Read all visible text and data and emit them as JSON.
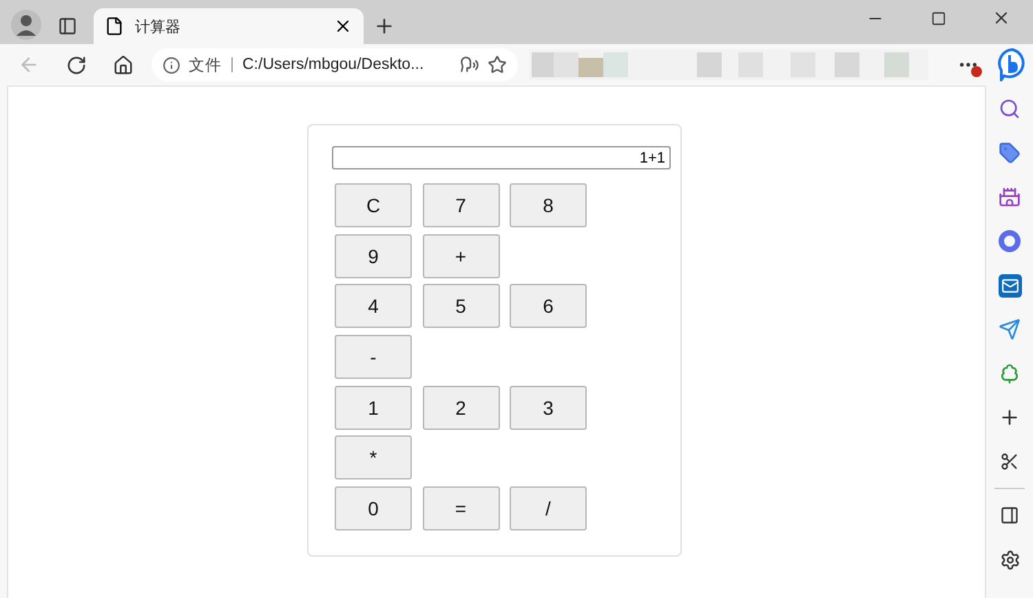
{
  "tab": {
    "title": "计算器",
    "selected": true
  },
  "address_bar": {
    "scheme_label": "文件",
    "separator": "|",
    "url": "C:/Users/mbgou/Deskto..."
  },
  "calculator": {
    "display": "1+1",
    "rows": [
      [
        "C",
        "7",
        "8"
      ],
      [
        "9",
        "+"
      ],
      [
        "4",
        "5",
        "6"
      ],
      [
        "-"
      ],
      [
        "1",
        "2",
        "3"
      ],
      [
        "*"
      ],
      [
        "0",
        "=",
        "/"
      ]
    ]
  }
}
